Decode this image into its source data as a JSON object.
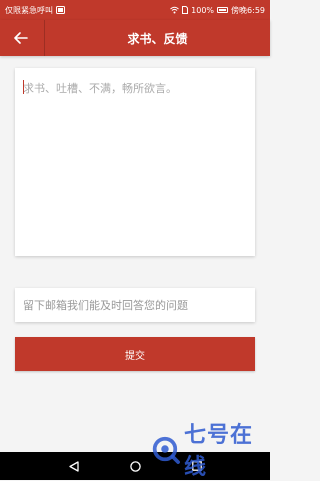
{
  "status_bar": {
    "left_text": "仅限紧急呼叫",
    "battery_text": "100%",
    "time_text": "傍晚6:59"
  },
  "toolbar": {
    "title": "求书、反馈"
  },
  "feedback": {
    "placeholder": "求书、吐槽、不满，畅所欲言。"
  },
  "contact": {
    "placeholder": "留下邮箱我们能及时回答您的问题"
  },
  "submit": {
    "label": "提交"
  },
  "watermark": {
    "text": "七号在线"
  },
  "colors": {
    "primary": "#c0392b",
    "background": "#f4f4f4",
    "watermark": "#2f5bd0"
  }
}
